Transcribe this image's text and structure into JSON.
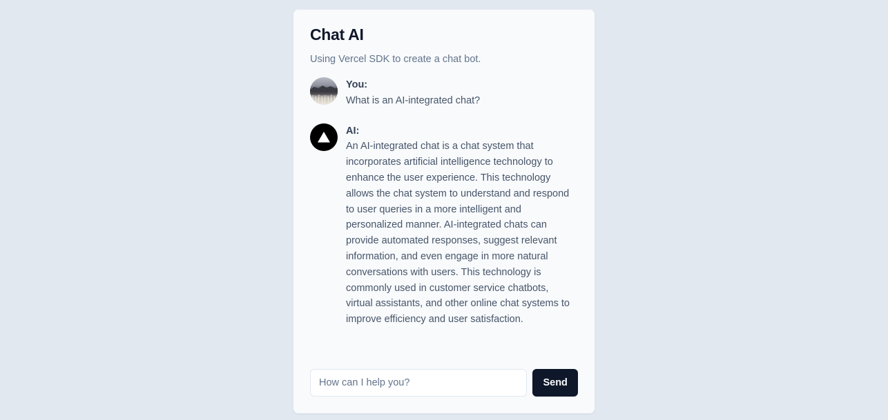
{
  "header": {
    "title": "Chat AI",
    "subtitle": "Using Vercel SDK to create a chat bot."
  },
  "messages": [
    {
      "sender": "You:",
      "avatar": "user-photo-avatar",
      "text": "What is an AI-integrated chat?"
    },
    {
      "sender": "AI:",
      "avatar": "vercel-triangle-icon",
      "text": "An AI-integrated chat is a chat system that incorporates artificial intelligence technology to enhance the user experience. This technology allows the chat system to understand and respond to user queries in a more intelligent and personalized manner. AI-integrated chats can provide automated responses, suggest relevant information, and even engage in more natural conversations with users. This technology is commonly used in customer service chatbots, virtual assistants, and other online chat systems to improve efficiency and user satisfaction."
    }
  ],
  "composer": {
    "placeholder": "How can I help you?",
    "value": "",
    "send_label": "Send"
  },
  "colors": {
    "page_background": "#e2e8f0",
    "card_background": "#f8fafc",
    "primary": "#0f172a",
    "muted_text": "#64748b"
  }
}
